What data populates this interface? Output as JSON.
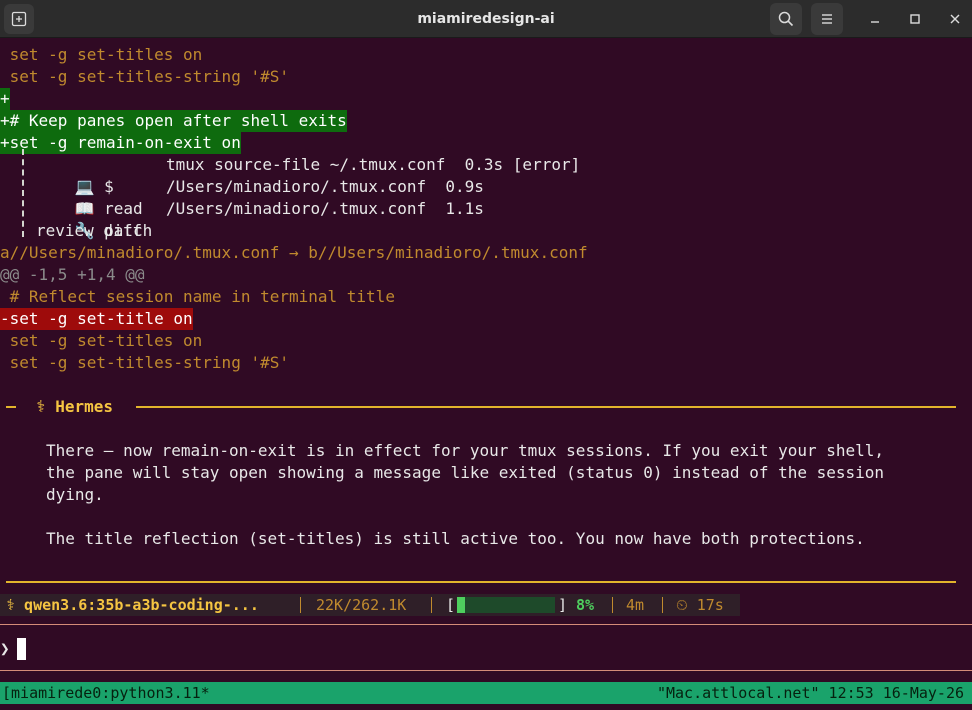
{
  "window": {
    "title": "miamiredesign-ai"
  },
  "terminal": {
    "lines_top": [
      {
        "text": " set -g set-titles on"
      },
      {
        "text": " set -g set-titles-string '#S'"
      },
      {
        "text": "+"
      },
      {
        "text": "+# Keep panes open after shell exits"
      },
      {
        "text": "+set -g remain-on-exit on"
      }
    ],
    "tool_calls": [
      {
        "icon": "💻",
        "verb": "$",
        "target": "tmux source-file ~/.tmux.conf",
        "time": "0.3s",
        "status": "[error]"
      },
      {
        "icon": "📖",
        "verb": "read",
        "target": "/Users/minadioro/.tmux.conf",
        "time": "0.9s",
        "status": ""
      },
      {
        "icon": "🔧",
        "verb": "patch",
        "target": "/Users/minadioro/.tmux.conf",
        "time": "1.1s",
        "status": ""
      }
    ],
    "review_label": "review diff",
    "diff_header": "a//Users/minadioro/.tmux.conf → b//Users/minadioro/.tmux.conf",
    "hunk_header": "@@ -1,5 +1,4 @@",
    "diff_lines": [
      {
        "text": " # Reflect session name in terminal title"
      },
      {
        "text": "-set -g set-title on"
      },
      {
        "text": " set -g set-titles on"
      },
      {
        "text": " set -g set-titles-string '#S'"
      }
    ],
    "hermes": {
      "label": "⚕ Hermes",
      "paragraph1": [
        "There — now remain-on-exit is in effect for your tmux sessions. If you exit your shell,",
        "the pane will stay open showing a message like exited (status 0) instead of the session",
        "dying."
      ],
      "paragraph2": [
        "The title reflection (set-titles) is still active too. You now have both protections."
      ]
    },
    "status_bar": {
      "model": "⚕ qwen3.6:35b-a3b-coding-...",
      "tokens": "22K/262.1K",
      "context_open": "[",
      "context_close": "]",
      "context_percent": "8%",
      "context_fraction": 0.08,
      "duration": "4m",
      "timer": "⏲ 17s"
    },
    "prompt_symbol": "❯"
  },
  "tmux": {
    "left": "[miamirede0:python3.11*",
    "right": "\"Mac.attlocal.net\" 12:53 16-May-26"
  },
  "colors": {
    "background": "#300a24",
    "added_line_bg": "#0e6b0e",
    "removed_line_bg": "#9e0b0b",
    "accent": "#e2b42c",
    "tmux_bar": "#1aa36b"
  }
}
